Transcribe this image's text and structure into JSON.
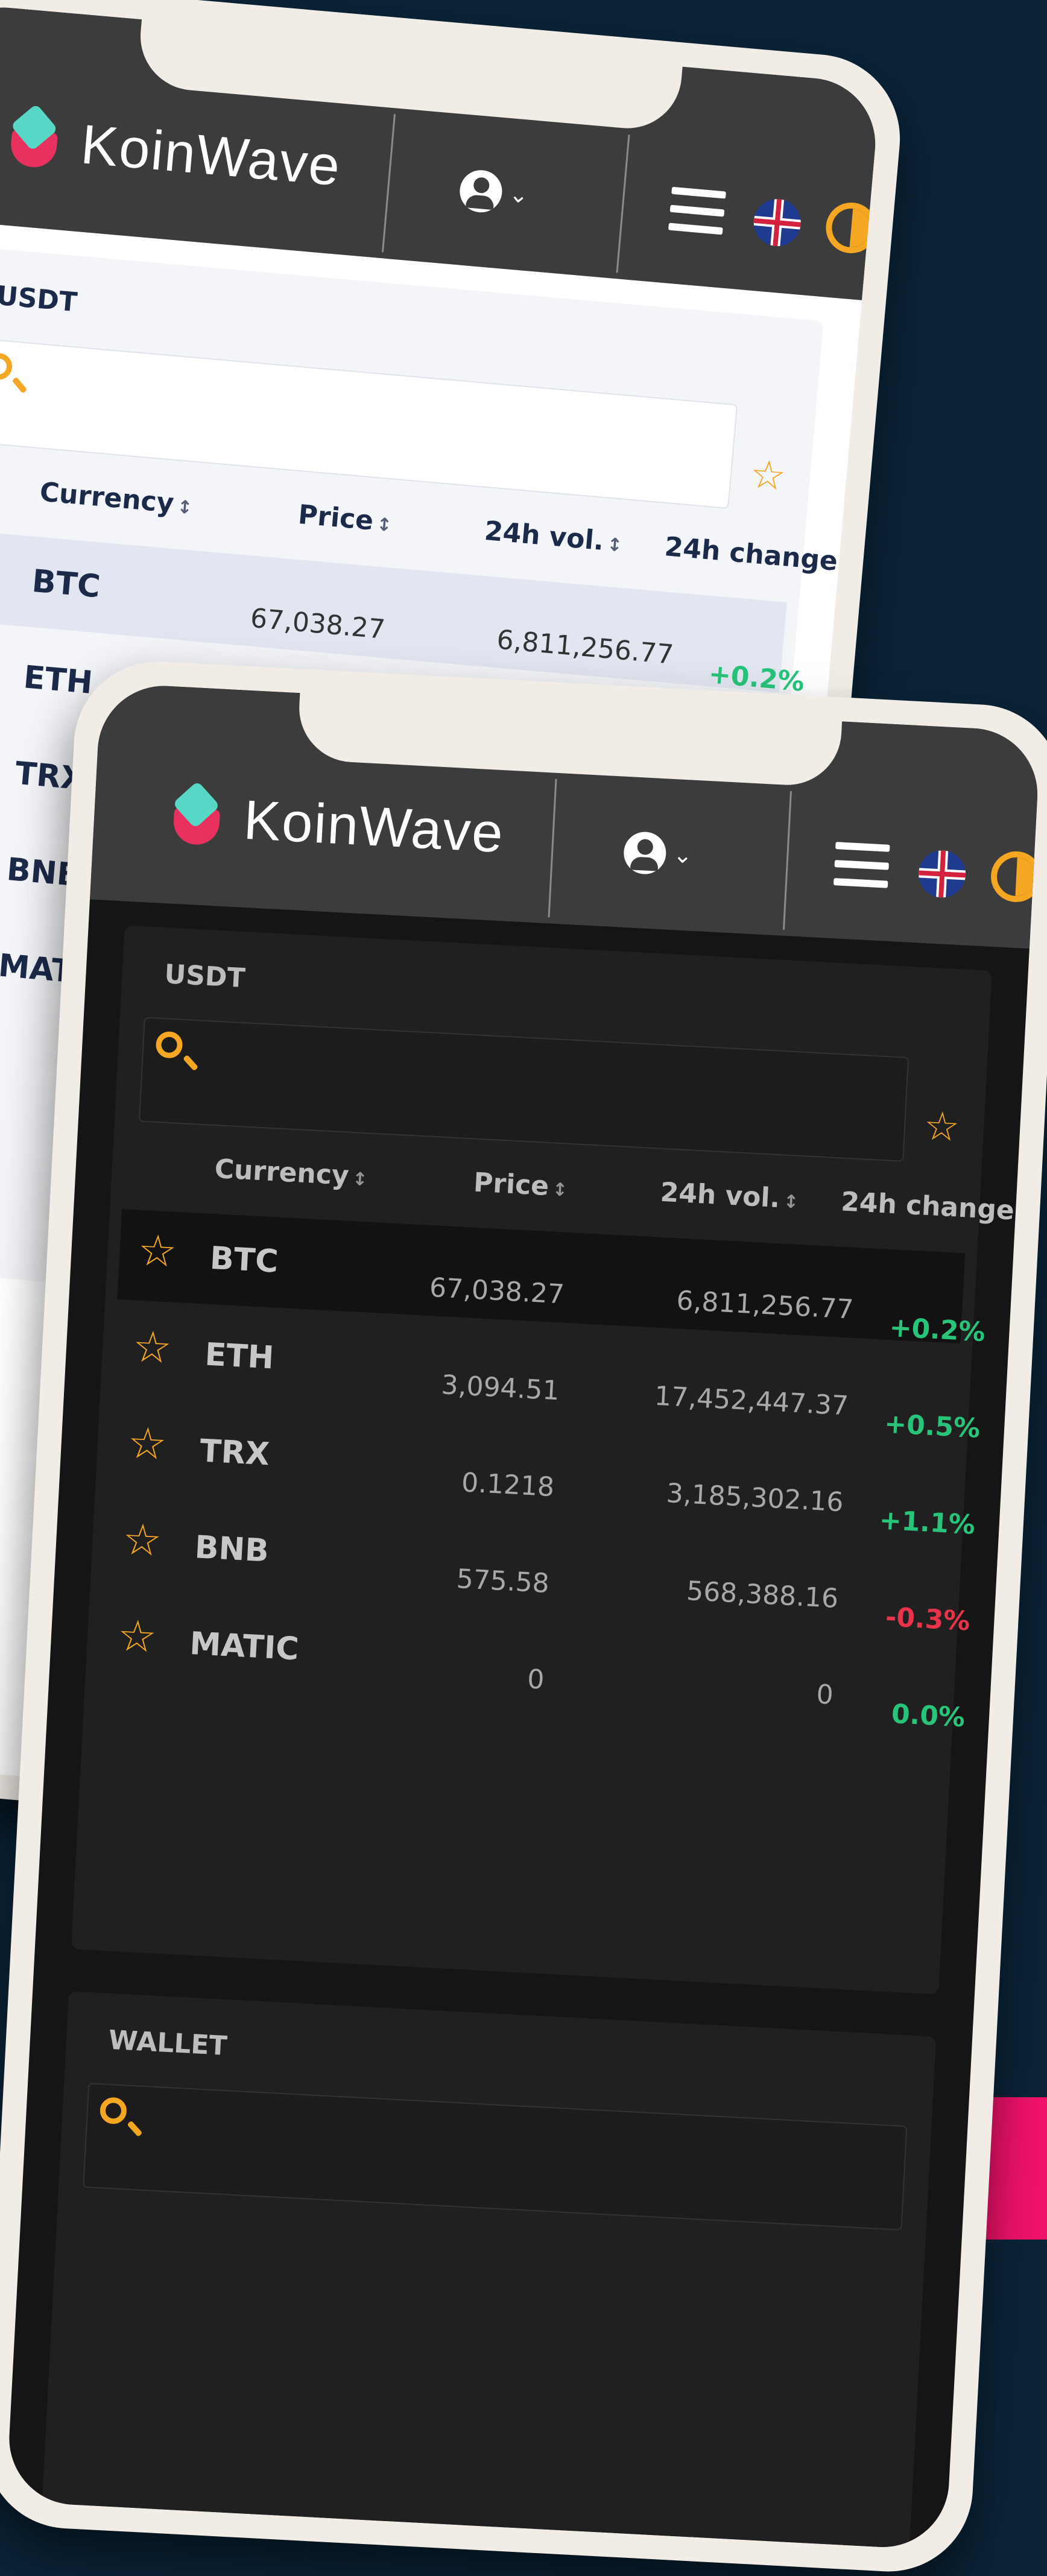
{
  "brand": "KoinWave",
  "market": {
    "section_title": "USDT",
    "columns": {
      "currency": "Currency",
      "price": "Price",
      "volume": "24h vol.",
      "change": "24h change"
    },
    "sort_glyph": "↕",
    "rows": [
      {
        "symbol": "BTC",
        "price": "67,038.27",
        "volume": "6,811,256.77",
        "change": "+0.2%",
        "direction": "up"
      },
      {
        "symbol": "ETH",
        "price": "3,094.51",
        "volume": "17,452,447.37",
        "change": "+0.5%",
        "direction": "up"
      },
      {
        "symbol": "TRX",
        "price": "0.1218",
        "volume": "3,185,302.16",
        "change": "+1.1%",
        "direction": "up"
      },
      {
        "symbol": "BNB",
        "price": "575.58",
        "volume": "568,388.16",
        "change": "-0.3%",
        "direction": "down"
      },
      {
        "symbol": "MATIC",
        "price": "0",
        "volume": "0",
        "change": "0.0%",
        "direction": "flat"
      }
    ]
  },
  "wallet": {
    "section_title": "WALLET"
  },
  "icons": {
    "logo": "koinwave-logo-icon",
    "user": "user-icon",
    "menu": "hamburger-menu-icon",
    "language": "uk-flag-icon",
    "theme": "theme-toggle-icon",
    "search": "search-icon",
    "favorite": "star-icon"
  },
  "colors": {
    "background": "#0b2438",
    "accent_pink": "#f0126a",
    "star": "#f5a623",
    "positive": "#27c47a",
    "negative": "#e8344b"
  },
  "star_glyph": "☆"
}
